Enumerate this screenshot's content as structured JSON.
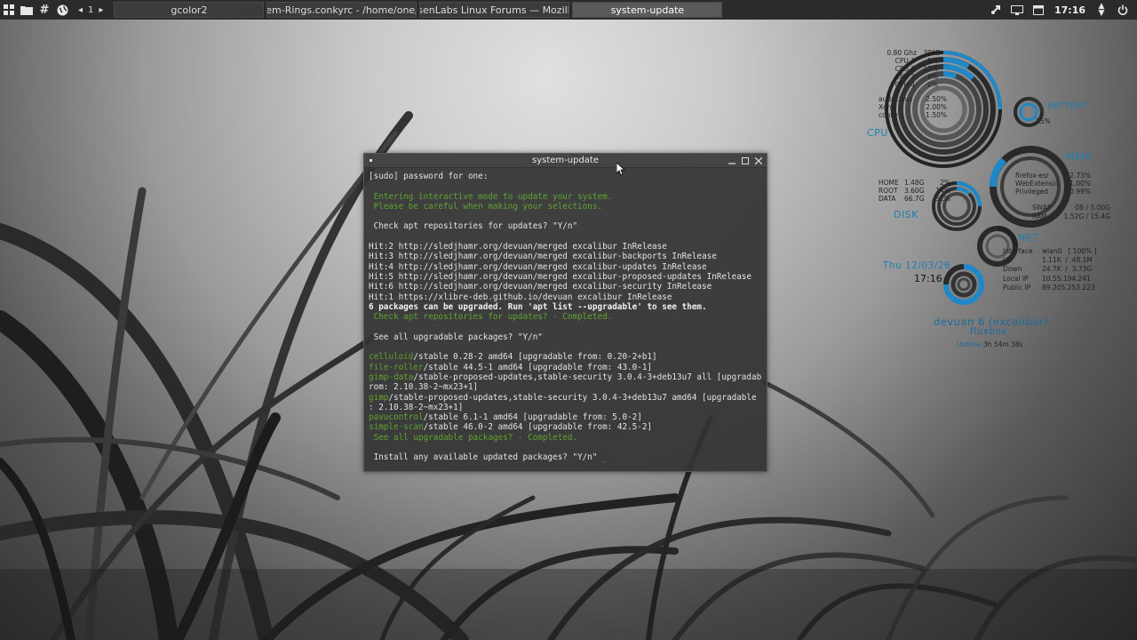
{
  "panel": {
    "workspace_number": "1",
    "tasks": [
      {
        "label": "gcolor2"
      },
      {
        "label": "System-Rings.conkyrc - /home/one/.con"
      },
      {
        "label": "BunsenLabs Linux Forums — Mozilla Fir"
      },
      {
        "label": "system-update"
      }
    ],
    "clock": "17:16"
  },
  "terminal": {
    "title": "system-update",
    "lines": [
      {
        "t": "[sudo] password for one:",
        "c": ""
      },
      {
        "t": "",
        "c": ""
      },
      {
        "t": " Entering interactive mode to update your system.",
        "c": "g"
      },
      {
        "t": " Please be careful when making your selections.",
        "c": "g"
      },
      {
        "t": "",
        "c": ""
      },
      {
        "t": " Check apt repositories for updates? \"Y/n\"",
        "c": ""
      },
      {
        "t": "",
        "c": ""
      },
      {
        "t": "Hit:2 http://sledjhamr.org/devuan/merged excalibur InRelease",
        "c": ""
      },
      {
        "t": "Hit:3 http://sledjhamr.org/devuan/merged excalibur-backports InRelease",
        "c": ""
      },
      {
        "t": "Hit:4 http://sledjhamr.org/devuan/merged excalibur-updates InRelease",
        "c": ""
      },
      {
        "t": "Hit:5 http://sledjhamr.org/devuan/merged excalibur-proposed-updates InRelease",
        "c": ""
      },
      {
        "t": "Hit:6 http://sledjhamr.org/devuan/merged excalibur-security InRelease",
        "c": ""
      },
      {
        "t": "Hit:1 https://xlibre-deb.github.io/devuan excalibur InRelease",
        "c": ""
      },
      {
        "t": "6 packages can be upgraded. Run 'apt list --upgradable' to see them.",
        "c": "b"
      },
      {
        "t": " Check apt repositories for updates? - Completed.",
        "c": "g"
      },
      {
        "t": "",
        "c": ""
      },
      {
        "t": " See all upgradable packages? \"Y/n\"",
        "c": ""
      },
      {
        "t": "",
        "c": ""
      },
      {
        "pkg": "celluloid",
        "t": "/stable 0.28-2 amd64 [upgradable from: 0.20-2+b1]"
      },
      {
        "pkg": "file-roller",
        "t": "/stable 44.5-1 amd64 [upgradable from: 43.0-1]"
      },
      {
        "pkg": "gimp-data",
        "t": "/stable-proposed-updates,stable-security 3.0.4-3+deb13u7 all [upgradable f"
      },
      {
        "t": "rom: 2.10.38-2~mx23+1]",
        "c": ""
      },
      {
        "pkg": "gimp",
        "t": "/stable-proposed-updates,stable-security 3.0.4-3+deb13u7 amd64 [upgradable from"
      },
      {
        "t": ": 2.10.38-2~mx23+1]",
        "c": ""
      },
      {
        "pkg": "pavucontrol",
        "t": "/stable 6.1-1 amd64 [upgradable from: 5.0-2]"
      },
      {
        "pkg": "simple-scan",
        "t": "/stable 46.0-2 amd64 [upgradable from: 42.5-2]"
      },
      {
        "t": " See all upgradable packages? - Completed.",
        "c": "g"
      },
      {
        "t": "",
        "c": ""
      },
      {
        "t": " Install any available updated packages? \"Y/n\" ",
        "c": "",
        "cursor": "_"
      }
    ]
  },
  "conky": {
    "cpu": {
      "label": "CPU",
      "freq": "0.80 Ghz",
      "temp": "39°C",
      "cores": [
        {
          "name": "CPU 1",
          "value": "9%"
        },
        {
          "name": "CPU 2",
          "value": "13%"
        },
        {
          "name": "CPU 3",
          "value": "6%"
        },
        {
          "name": "CPU 4",
          "value": "0%"
        }
      ],
      "procs": [
        {
          "name": "audacious",
          "value": "2.50%"
        },
        {
          "name": "Xorg",
          "value": "2.00%"
        },
        {
          "name": "conky",
          "value": "1.50%"
        }
      ]
    },
    "battery": {
      "label": "BATTERY",
      "value": "25%"
    },
    "mem": {
      "label": "MEM",
      "procs": [
        {
          "name": "firefox-esr",
          "value": "2.73%"
        },
        {
          "name": "WebExtensio",
          "value": "1.00%"
        },
        {
          "name": "Privileged",
          "value": "0.99%"
        }
      ],
      "swap_label": "SWAP",
      "swap_value": "0B / 5.00G",
      "ram_label": "RAM",
      "ram_value": "1.52G / 15.4G"
    },
    "disk": {
      "label": "DISK",
      "items": [
        {
          "name": "HOME",
          "size": "1.48G",
          "pct": "2%"
        },
        {
          "name": "ROOT",
          "size": "3.60G",
          "pct": "14%"
        },
        {
          "name": "DATA",
          "size": "66.7G",
          "pct": "52%"
        }
      ]
    },
    "net": {
      "label": "NET",
      "rows": [
        {
          "name": "Interface",
          "value": "wlan0   [ 100% ]"
        },
        {
          "name": "Up",
          "value": "1.11K  /  48.1M"
        },
        {
          "name": "Down",
          "value": "24.7K  /  3.73G"
        },
        {
          "name": "Local IP",
          "value": "10.55.194.241"
        },
        {
          "name": "Public IP",
          "value": "89.205.253.223"
        }
      ]
    },
    "date": "Thu 12/03/26",
    "time": "17:16",
    "distro": "devuan 6 (excalibur)",
    "wm": "fluxbox",
    "uptime_label": "Uptime",
    "uptime_value": "3h 54m 38s",
    "accent": "#1e88c8"
  }
}
